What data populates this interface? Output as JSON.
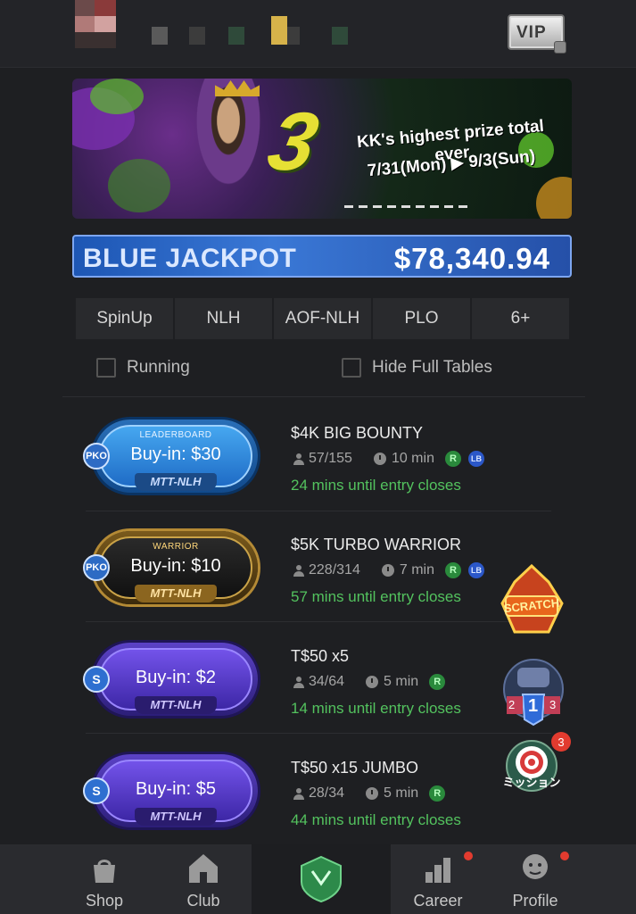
{
  "header": {
    "vip_label": "VIP"
  },
  "banner": {
    "line1": "KK's highest prize total ever",
    "line2": "7/31(Mon) ▶ 9/3(Sun)"
  },
  "jackpot": {
    "label": "BLUE JACKPOT",
    "amount": "$78,340.94"
  },
  "tabs": [
    {
      "label": "SpinUp"
    },
    {
      "label": "NLH"
    },
    {
      "label": "AOF-NLH"
    },
    {
      "label": "PLO"
    },
    {
      "label": "6+"
    }
  ],
  "filters": {
    "running": "Running",
    "hide_full": "Hide Full Tables"
  },
  "tournaments": [
    {
      "tag": "LEADERBOARD",
      "badge": "PKO",
      "buyin": "Buy-in: $30",
      "type": "MTT-NLH",
      "title": "$4K BIG BOUNTY",
      "players": "57/155",
      "duration": "10 min",
      "r": "R",
      "lb": "LB",
      "closes": "24 mins until entry closes"
    },
    {
      "tag": "WARRIOR",
      "badge": "PKO",
      "buyin": "Buy-in: $10",
      "type": "MTT-NLH",
      "title": "$5K TURBO WARRIOR",
      "players": "228/314",
      "duration": "7 min",
      "r": "R",
      "lb": "LB",
      "closes": "57 mins until entry closes"
    },
    {
      "tag": "",
      "badge": "S",
      "buyin": "Buy-in: $2",
      "type": "MTT-NLH",
      "title": "T$50 x5",
      "players": "34/64",
      "duration": "5 min",
      "r": "R",
      "closes": "14 mins until entry closes"
    },
    {
      "tag": "",
      "badge": "S",
      "buyin": "Buy-in: $5",
      "type": "MTT-NLH",
      "title": "T$50 x15 JUMBO",
      "players": "28/34",
      "duration": "5 min",
      "r": "R",
      "closes": "44 mins until entry closes"
    }
  ],
  "side_icons": {
    "scratch_label": "SCRATCH",
    "rank_numbers": [
      "2",
      "1",
      "3"
    ],
    "mission_label": "ミッション",
    "mission_count": "3"
  },
  "nav": [
    {
      "label": "Shop"
    },
    {
      "label": "Club"
    },
    {
      "label": ""
    },
    {
      "label": "Career"
    },
    {
      "label": "Profile"
    }
  ],
  "colors": {
    "accent_green": "#53c25e",
    "jackpot_blue": "#2a6fd0",
    "notification_red": "#e23b2f"
  }
}
